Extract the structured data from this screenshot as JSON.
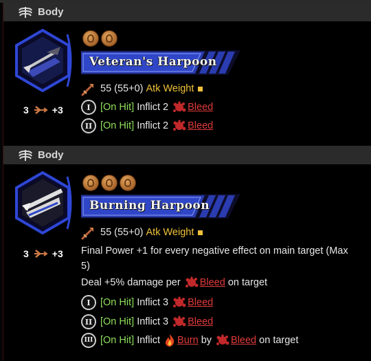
{
  "cards": [
    {
      "section_label": "Body",
      "name": "Veteran's Harpoon",
      "cost": {
        "left": "3",
        "right": "+3"
      },
      "coins": 2,
      "attack": {
        "value": "55 (55+0)",
        "label": "Atk Weight"
      },
      "effects": [
        {
          "roman": "I",
          "tag": "[On Hit]",
          "text": "Inflict 2",
          "status": "Bleed"
        },
        {
          "roman": "II",
          "tag": "[On Hit]",
          "text": "Inflict 2",
          "status": "Bleed"
        }
      ]
    },
    {
      "section_label": "Body",
      "name": "Burning Harpoon",
      "cost": {
        "left": "3",
        "right": "+3"
      },
      "coins": 3,
      "attack": {
        "value": "55 (55+0)",
        "label": "Atk Weight"
      },
      "passive_1": "Final Power +1 for every negative effect on main target (Max 5)",
      "passive_1_line1": "Final Power +1 for every negative effect on main target (Max",
      "passive_1_line2": "5)",
      "passive_2_pre": "Deal +5% damage per",
      "passive_2_status": "Bleed",
      "passive_2_post": "on target",
      "effects": [
        {
          "roman": "I",
          "tag": "[On Hit]",
          "text": "Inflict 3",
          "status": "Bleed"
        },
        {
          "roman": "II",
          "tag": "[On Hit]",
          "text": "Inflict 3",
          "status": "Bleed"
        },
        {
          "roman": "III",
          "tag": "[On Hit]",
          "text": "Inflict",
          "status": "Burn",
          "mid": "by",
          "status2": "Bleed",
          "post": "on target"
        }
      ]
    }
  ],
  "colors": {
    "accent_blue": "#2a3cb0",
    "keyword_yellow": "#f0c23a",
    "on_hit_green": "#8fe05a",
    "status_red": "#e03a3a"
  },
  "icons": {
    "section": "ribcage-icon",
    "cost": "arrow-icon",
    "attack": "harpoon-attack-icon",
    "bleed": "blood-splat-icon",
    "burn": "flame-icon"
  }
}
